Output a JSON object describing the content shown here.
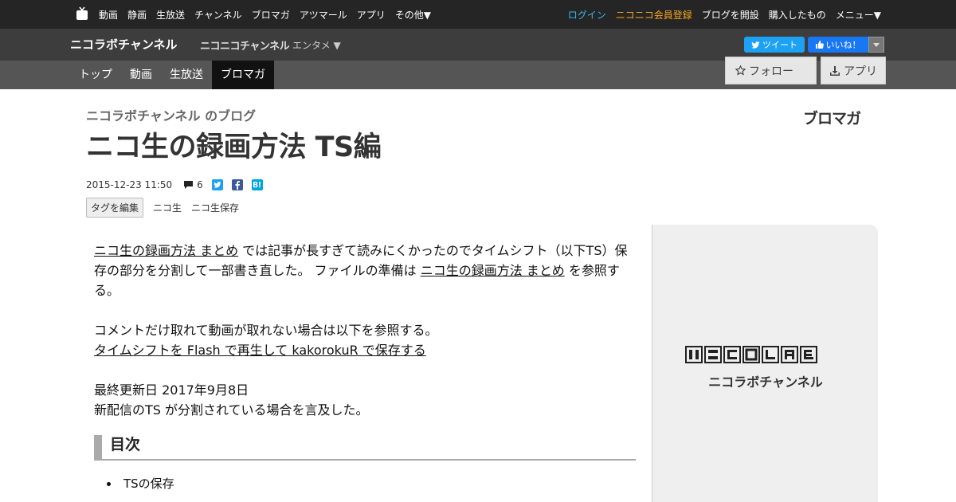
{
  "topnav": {
    "left": [
      "動画",
      "静画",
      "生放送",
      "チャンネル",
      "ブロマガ",
      "アツマール",
      "アプリ",
      "その他▼"
    ],
    "right": {
      "login": "ログイン",
      "register": "ニコニコ会員登録",
      "open_blog": "ブログを開設",
      "purchased": "購入したもの",
      "menu": "メニュー▼"
    }
  },
  "channel": {
    "name": "ニコラボチャンネル",
    "nico_channel_logo": "ニコニコチャンネル",
    "genre": "エンタメ ▼",
    "tweet": "ツイート",
    "like": "いいね！",
    "follow": "フォロー",
    "app": "アプリ"
  },
  "tabs": [
    "トップ",
    "動画",
    "生放送",
    "ブロマガ"
  ],
  "article": {
    "blog_of": "ニコラボチャンネル のブログ",
    "title": "ニコ生の録画方法 TS編",
    "blomaga_logo": "ブロマガ",
    "date": "2015-12-23 11:50",
    "comment_count": "6",
    "edit_tags": "タグを編集",
    "tags": [
      "ニコ生",
      "ニコ生保存"
    ]
  },
  "body": {
    "p1_link1": "ニコ生の録画方法 まとめ",
    "p1_text1": " では記事が長すぎて読みにくかったのでタイムシフト（以下TS）保存の部分を分割して一部書き直した。 ファイルの準備は ",
    "p1_link2": "ニコ生の録画方法 まとめ",
    "p1_text2": " を参照する。",
    "p2_text": "コメントだけ取れて動画が取れない場合は以下を参照する。",
    "p2_link": "タイムシフトを Flash で再生して kakorokuR で保存する",
    "p3_line1": "最終更新日 2017年9月8日",
    "p3_line2": "新配信のTS が分割されている場合を言及した。",
    "toc_title": "目次",
    "toc_items": [
      "TSの保存"
    ]
  },
  "sidebar": {
    "channel_name": "ニコラボチャンネル"
  },
  "colors": {
    "topbar": "#252525",
    "chanbar": "#3d3d3d",
    "tabbar": "#555555",
    "login": "#3bb5f0",
    "register": "#f5a623",
    "twitter": "#1da1f2",
    "facebook": "#1877f2"
  }
}
